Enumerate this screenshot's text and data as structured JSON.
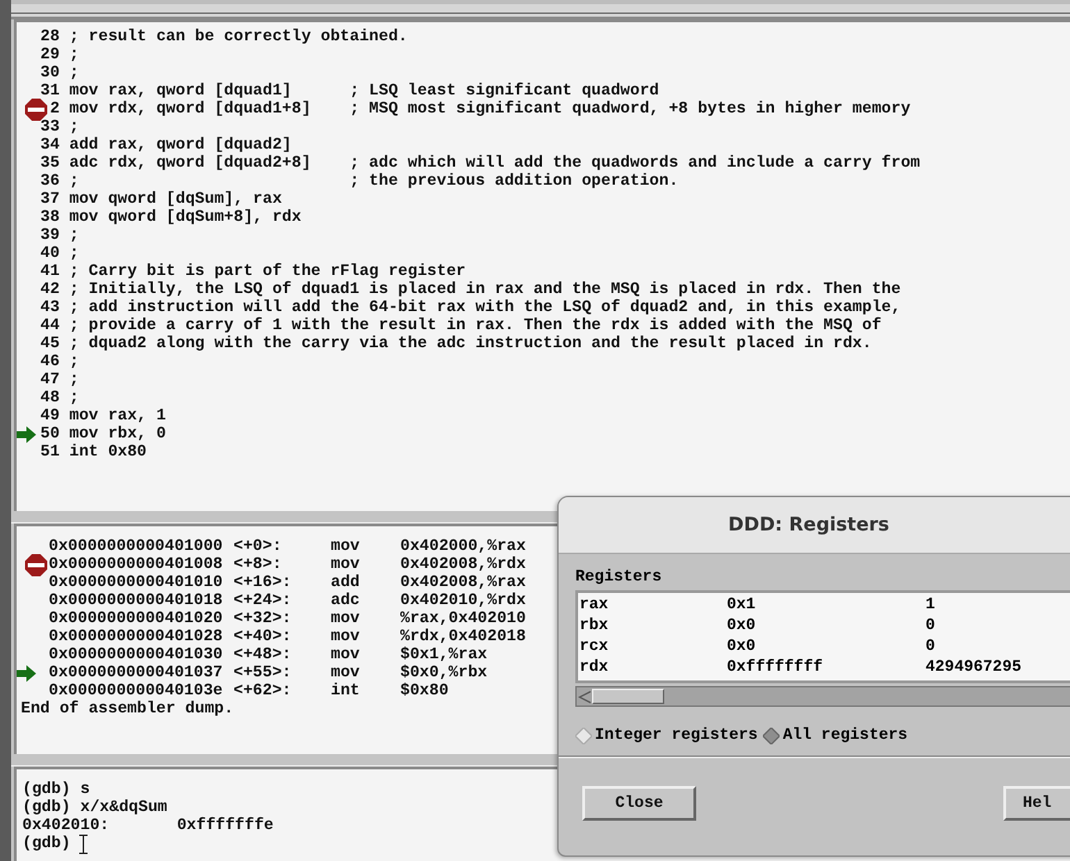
{
  "source": {
    "lines": [
      {
        "number": "28",
        "text": "; result can be correctly obtained.",
        "breakpoint": false,
        "current": false
      },
      {
        "number": "29",
        "text": ";",
        "breakpoint": false,
        "current": false
      },
      {
        "number": "30",
        "text": ";",
        "breakpoint": false,
        "current": false
      },
      {
        "number": "31",
        "text": "mov rax, qword [dquad1]      ; LSQ least significant quadword",
        "breakpoint": false,
        "current": false
      },
      {
        "number": "2",
        "text": "mov rdx, qword [dquad1+8]    ; MSQ most significant quadword, +8 bytes in higher memory",
        "breakpoint": true,
        "current": false
      },
      {
        "number": "33",
        "text": ";",
        "breakpoint": false,
        "current": false
      },
      {
        "number": "34",
        "text": "add rax, qword [dquad2]",
        "breakpoint": false,
        "current": false
      },
      {
        "number": "35",
        "text": "adc rdx, qword [dquad2+8]    ; adc which will add the quadwords and include a carry from",
        "breakpoint": false,
        "current": false
      },
      {
        "number": "36",
        "text": ";                            ; the previous addition operation.",
        "breakpoint": false,
        "current": false
      },
      {
        "number": "37",
        "text": "mov qword [dqSum], rax",
        "breakpoint": false,
        "current": false
      },
      {
        "number": "38",
        "text": "mov qword [dqSum+8], rdx",
        "breakpoint": false,
        "current": false
      },
      {
        "number": "39",
        "text": ";",
        "breakpoint": false,
        "current": false
      },
      {
        "number": "40",
        "text": ";",
        "breakpoint": false,
        "current": false
      },
      {
        "number": "41",
        "text": "; Carry bit is part of the rFlag register",
        "breakpoint": false,
        "current": false
      },
      {
        "number": "42",
        "text": "; Initially, the LSQ of dquad1 is placed in rax and the MSQ is placed in rdx. Then the",
        "breakpoint": false,
        "current": false
      },
      {
        "number": "43",
        "text": "; add instruction will add the 64-bit rax with the LSQ of dquad2 and, in this example,",
        "breakpoint": false,
        "current": false
      },
      {
        "number": "44",
        "text": "; provide a carry of 1 with the result in rax. Then the rdx is added with the MSQ of",
        "breakpoint": false,
        "current": false
      },
      {
        "number": "45",
        "text": "; dquad2 along with the carry via the adc instruction and the result placed in rdx.",
        "breakpoint": false,
        "current": false
      },
      {
        "number": "46",
        "text": ";",
        "breakpoint": false,
        "current": false
      },
      {
        "number": "47",
        "text": ";",
        "breakpoint": false,
        "current": false
      },
      {
        "number": "48",
        "text": ";",
        "breakpoint": false,
        "current": false
      },
      {
        "number": "49",
        "text": "mov rax, 1",
        "breakpoint": false,
        "current": false
      },
      {
        "number": "50",
        "text": "mov rbx, 0",
        "breakpoint": false,
        "current": true
      },
      {
        "number": "51",
        "text": "int 0x80",
        "breakpoint": false,
        "current": false
      }
    ]
  },
  "assembler": {
    "rows": [
      {
        "address": "0x0000000000401000",
        "offset": "<+0>:",
        "mnemonic": "mov",
        "operands": "0x402000,%rax",
        "breakpoint": false,
        "current": false
      },
      {
        "address": "0x0000000000401008",
        "offset": "<+8>:",
        "mnemonic": "mov",
        "operands": "0x402008,%rdx",
        "breakpoint": true,
        "current": false
      },
      {
        "address": "0x0000000000401010",
        "offset": "<+16>:",
        "mnemonic": "add",
        "operands": "0x402008,%rax",
        "breakpoint": false,
        "current": false
      },
      {
        "address": "0x0000000000401018",
        "offset": "<+24>:",
        "mnemonic": "adc",
        "operands": "0x402010,%rdx",
        "breakpoint": false,
        "current": false
      },
      {
        "address": "0x0000000000401020",
        "offset": "<+32>:",
        "mnemonic": "mov",
        "operands": "%rax,0x402010",
        "breakpoint": false,
        "current": false
      },
      {
        "address": "0x0000000000401028",
        "offset": "<+40>:",
        "mnemonic": "mov",
        "operands": "%rdx,0x402018",
        "breakpoint": false,
        "current": false
      },
      {
        "address": "0x0000000000401030",
        "offset": "<+48>:",
        "mnemonic": "mov",
        "operands": "$0x1,%rax",
        "breakpoint": false,
        "current": false
      },
      {
        "address": "0x0000000000401037",
        "offset": "<+55>:",
        "mnemonic": "mov",
        "operands": "$0x0,%rbx",
        "breakpoint": false,
        "current": true
      },
      {
        "address": "0x000000000040103e",
        "offset": "<+62>:",
        "mnemonic": "int",
        "operands": "$0x80",
        "breakpoint": false,
        "current": false
      }
    ],
    "footer": "End of assembler dump."
  },
  "console": {
    "lines": [
      "(gdb) s",
      "(gdb) x/x&dqSum",
      "0x402010:       0xfffffffe"
    ],
    "prompt": "(gdb)"
  },
  "dialog": {
    "title": "DDD: Registers",
    "label": "Registers",
    "registers": [
      {
        "name": "rax",
        "hex": "0x1",
        "value": "1"
      },
      {
        "name": "rbx",
        "hex": "0x0",
        "value": "0"
      },
      {
        "name": "rcx",
        "hex": "0x0",
        "value": "0"
      },
      {
        "name": "rdx",
        "hex": "0xffffffff",
        "value": "4294967295"
      }
    ],
    "options": [
      {
        "label": "Integer registers",
        "selected": false
      },
      {
        "label": "All registers",
        "selected": true
      }
    ],
    "buttons": [
      "Close",
      "Hel"
    ]
  }
}
